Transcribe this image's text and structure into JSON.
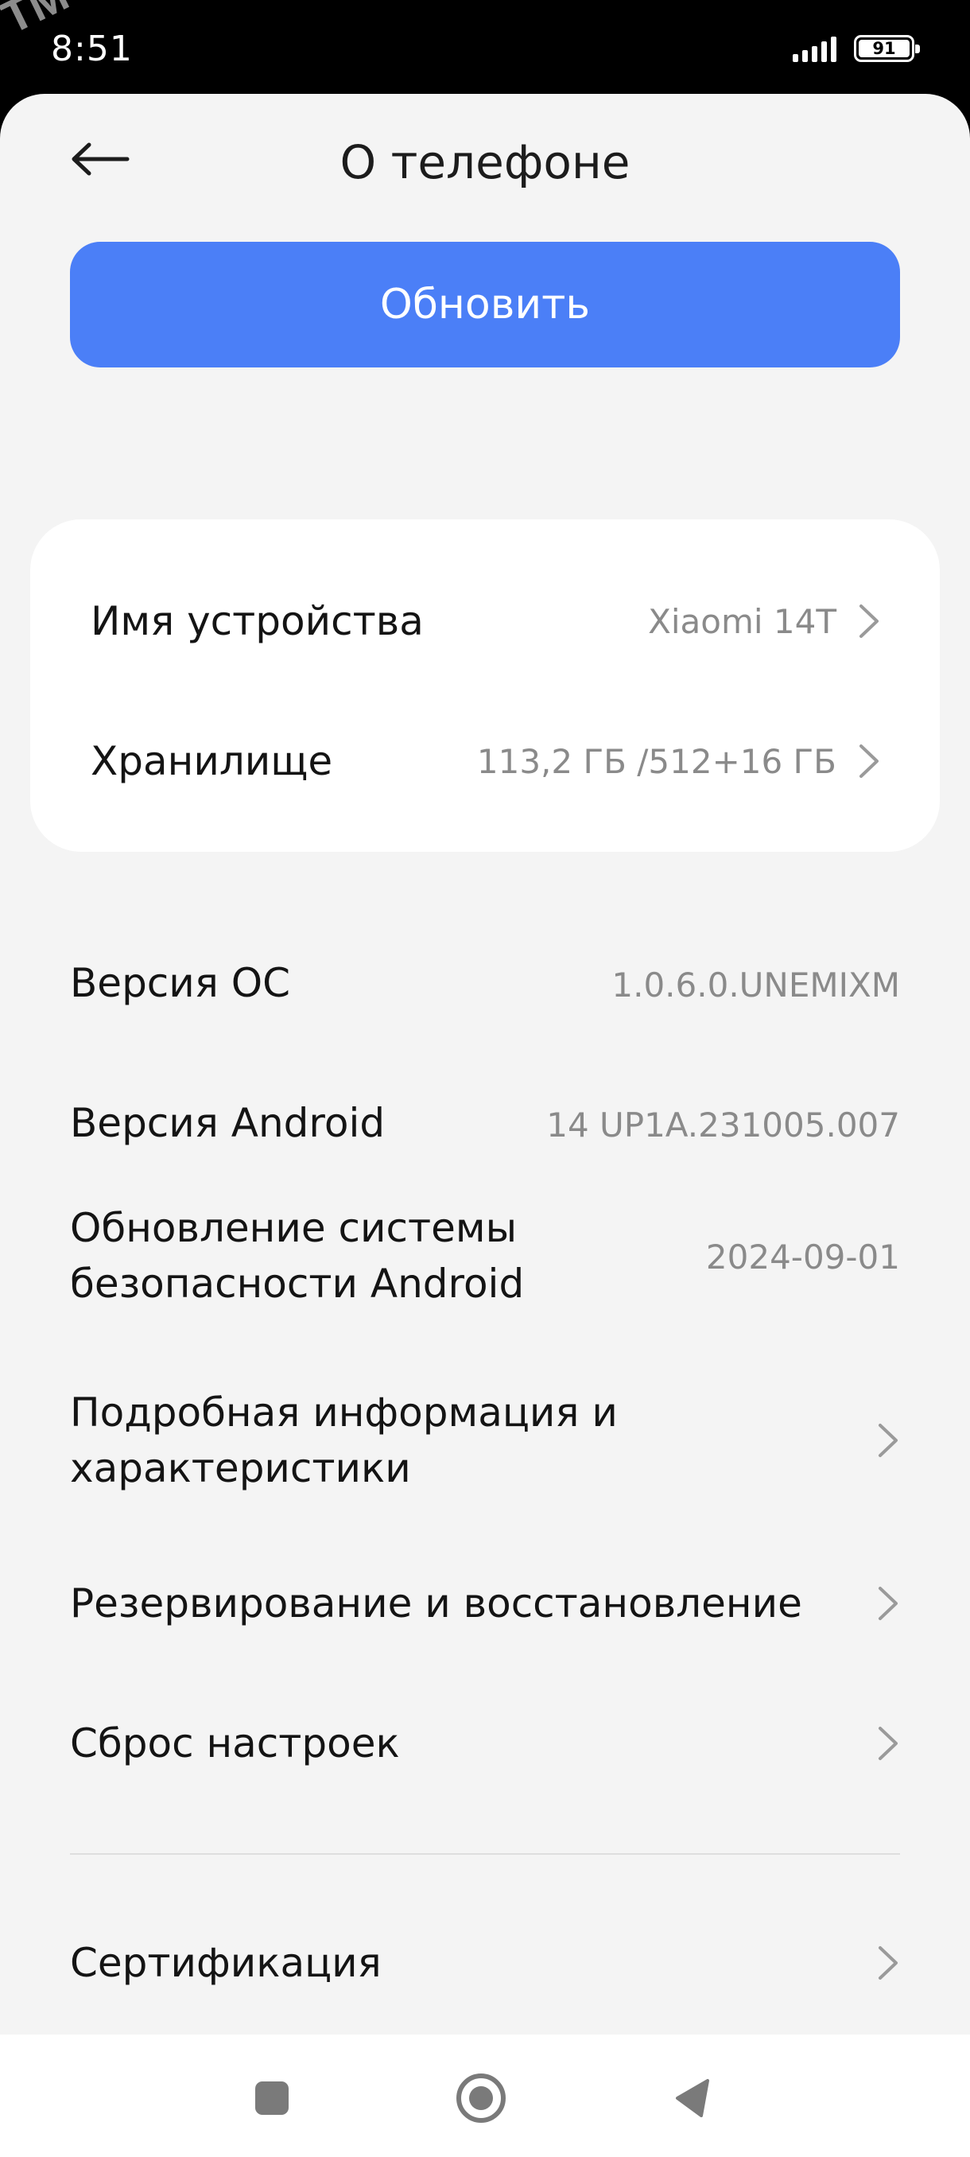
{
  "status_bar": {
    "time": "8:51",
    "battery_level": "91",
    "watermark": "TM"
  },
  "header": {
    "title": "О телефоне",
    "back_icon": "arrow-left-icon"
  },
  "update_button": {
    "label": "Обновить",
    "color": "#4b7ff7"
  },
  "device_card": {
    "rows": [
      {
        "label": "Имя устройства",
        "value": "Xiaomi 14T"
      },
      {
        "label": "Хранилище",
        "value": "113,2 ГБ /512+16 ГБ"
      }
    ]
  },
  "info": {
    "os_version": {
      "label": "Версия ОС",
      "value": "1.0.6.0.UNEMIXM"
    },
    "android_version": {
      "label": "Версия Android",
      "value": "14 UP1A.231005.007"
    },
    "security_update": {
      "label_line1": "Обновление системы",
      "label_line2": "безопасности Android",
      "value": "2024-09-01"
    },
    "details": {
      "label_line1": "Подробная информация и",
      "label_line2": "характеристики"
    },
    "backup": {
      "label": "Резервирование и восстановление"
    },
    "reset": {
      "label": "Сброс настроек"
    },
    "certification": {
      "label": "Сертификация"
    }
  },
  "nav_bar": {
    "recents_icon": "square-icon",
    "home_icon": "circle-icon",
    "back_icon": "triangle-back-icon"
  }
}
